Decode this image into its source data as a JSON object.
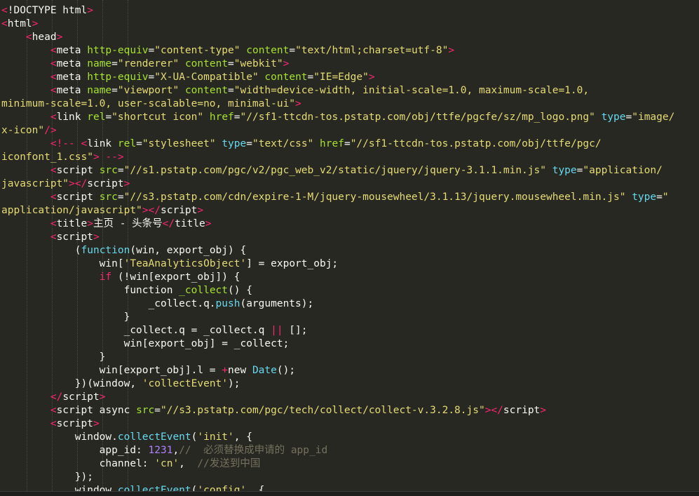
{
  "editor": {
    "theme_colors": {
      "background": "#272822",
      "tag": "#F92672",
      "attribute": "#A6E22E",
      "string": "#E6DB74",
      "keyword": "#66D9EF",
      "number": "#AE81FF",
      "comment": "#75715E",
      "text": "#F8F8F2"
    },
    "lines": [
      [
        [
          "tag",
          "<"
        ],
        [
          "plain",
          "!DOCTYPE html"
        ],
        [
          "tag",
          ">"
        ]
      ],
      [
        [
          "tag",
          "<"
        ],
        [
          "plain",
          "html"
        ],
        [
          "tag",
          ">"
        ]
      ],
      [
        [
          "plain",
          "    "
        ],
        [
          "tag",
          "<"
        ],
        [
          "plain",
          "head"
        ],
        [
          "tag",
          ">"
        ]
      ],
      [
        [
          "plain",
          "        "
        ],
        [
          "tag",
          "<"
        ],
        [
          "plain",
          "meta "
        ],
        [
          "attr",
          "http-equiv"
        ],
        [
          "plain",
          "="
        ],
        [
          "str",
          "\"content-type\""
        ],
        [
          "plain",
          " "
        ],
        [
          "attr",
          "content"
        ],
        [
          "plain",
          "="
        ],
        [
          "str",
          "\"text/html;charset=utf-8\""
        ],
        [
          "tag",
          ">"
        ]
      ],
      [
        [
          "plain",
          "        "
        ],
        [
          "tag",
          "<"
        ],
        [
          "plain",
          "meta "
        ],
        [
          "attr",
          "name"
        ],
        [
          "plain",
          "="
        ],
        [
          "str",
          "\"renderer\""
        ],
        [
          "plain",
          " "
        ],
        [
          "attr",
          "content"
        ],
        [
          "plain",
          "="
        ],
        [
          "str",
          "\"webkit\""
        ],
        [
          "tag",
          ">"
        ]
      ],
      [
        [
          "plain",
          "        "
        ],
        [
          "tag",
          "<"
        ],
        [
          "plain",
          "meta "
        ],
        [
          "attr",
          "http-equiv"
        ],
        [
          "plain",
          "="
        ],
        [
          "str",
          "\"X-UA-Compatible\""
        ],
        [
          "plain",
          " "
        ],
        [
          "attr",
          "content"
        ],
        [
          "plain",
          "="
        ],
        [
          "str",
          "\"IE=Edge\""
        ],
        [
          "tag",
          ">"
        ]
      ],
      [
        [
          "plain",
          "        "
        ],
        [
          "tag",
          "<"
        ],
        [
          "plain",
          "meta "
        ],
        [
          "attr",
          "name"
        ],
        [
          "plain",
          "="
        ],
        [
          "str",
          "\"viewport\""
        ],
        [
          "plain",
          " "
        ],
        [
          "attr",
          "content"
        ],
        [
          "plain",
          "="
        ],
        [
          "str",
          "\"width=device-width, initial-scale=1.0, maximum-scale=1.0,"
        ]
      ],
      [
        [
          "str",
          "minimum-scale=1.0, user-scalable=no, minimal-ui\""
        ],
        [
          "tag",
          ">"
        ]
      ],
      [
        [
          "plain",
          "        "
        ],
        [
          "tag",
          "<"
        ],
        [
          "plain",
          "link "
        ],
        [
          "attr",
          "rel"
        ],
        [
          "plain",
          "="
        ],
        [
          "str",
          "\"shortcut icon\""
        ],
        [
          "plain",
          " "
        ],
        [
          "attr",
          "href"
        ],
        [
          "plain",
          "="
        ],
        [
          "str",
          "\"//sf1-ttcdn-tos.pstatp.com/obj/ttfe/pgcfe/sz/mp_logo.png\""
        ],
        [
          "plain",
          " "
        ],
        [
          "kw",
          "type"
        ],
        [
          "plain",
          "="
        ],
        [
          "str",
          "\"image/"
        ]
      ],
      [
        [
          "str",
          "x-icon\""
        ],
        [
          "tag",
          "/>"
        ]
      ],
      [
        [
          "plain",
          "        "
        ],
        [
          "tag",
          "<!--"
        ],
        [
          "plain",
          " "
        ],
        [
          "tag",
          "<"
        ],
        [
          "plain",
          "link "
        ],
        [
          "attr",
          "rel"
        ],
        [
          "plain",
          "="
        ],
        [
          "str",
          "\"stylesheet\""
        ],
        [
          "plain",
          " "
        ],
        [
          "kw",
          "type"
        ],
        [
          "plain",
          "="
        ],
        [
          "str",
          "\"text/css\""
        ],
        [
          "plain",
          " "
        ],
        [
          "attr",
          "href"
        ],
        [
          "plain",
          "="
        ],
        [
          "str",
          "\"//sf1-ttcdn-tos.pstatp.com/obj/ttfe/pgc/"
        ]
      ],
      [
        [
          "str",
          "iconfont_1.css\""
        ],
        [
          "tag",
          "> -->"
        ]
      ],
      [
        [
          "plain",
          "        "
        ],
        [
          "tag",
          "<"
        ],
        [
          "plain",
          "script "
        ],
        [
          "attr",
          "src"
        ],
        [
          "plain",
          "="
        ],
        [
          "str",
          "\"//s1.pstatp.com/pgc/v2/pgc_web_v2/static/jquery/jquery-3.1.1.min.js\""
        ],
        [
          "plain",
          " "
        ],
        [
          "kw",
          "type"
        ],
        [
          "plain",
          "="
        ],
        [
          "str",
          "\"application/"
        ]
      ],
      [
        [
          "str",
          "javascript\""
        ],
        [
          "tag",
          "></"
        ],
        [
          "plain",
          "script"
        ],
        [
          "tag",
          ">"
        ]
      ],
      [
        [
          "plain",
          "        "
        ],
        [
          "tag",
          "<"
        ],
        [
          "plain",
          "script "
        ],
        [
          "attr",
          "src"
        ],
        [
          "plain",
          "="
        ],
        [
          "str",
          "\"//s3.pstatp.com/cdn/expire-1-M/jquery-mousewheel/3.1.13/jquery.mousewheel.min.js\""
        ],
        [
          "plain",
          " "
        ],
        [
          "kw",
          "type"
        ],
        [
          "plain",
          "="
        ],
        [
          "str",
          "\""
        ]
      ],
      [
        [
          "str",
          "application/javascript\""
        ],
        [
          "tag",
          "></"
        ],
        [
          "plain",
          "script"
        ],
        [
          "tag",
          ">"
        ]
      ],
      [
        [
          "plain",
          "        "
        ],
        [
          "tag",
          "<"
        ],
        [
          "plain",
          "title"
        ],
        [
          "tag",
          ">"
        ],
        [
          "plain",
          "主页 - 头条号"
        ],
        [
          "tag",
          "</"
        ],
        [
          "plain",
          "title"
        ],
        [
          "tag",
          ">"
        ]
      ],
      [
        [
          "plain",
          "        "
        ],
        [
          "tag",
          "<"
        ],
        [
          "plain",
          "script"
        ],
        [
          "tag",
          ">"
        ]
      ],
      [
        [
          "plain",
          "            ("
        ],
        [
          "kw",
          "function"
        ],
        [
          "plain",
          "(win, export_obj) {"
        ]
      ],
      [
        [
          "plain",
          "                win["
        ],
        [
          "str",
          "'TeaAnalyticsObject'"
        ],
        [
          "plain",
          "] = export_obj;"
        ]
      ],
      [
        [
          "plain",
          "                "
        ],
        [
          "tag",
          "if"
        ],
        [
          "plain",
          " (!win[export_obj]) {"
        ]
      ],
      [
        [
          "plain",
          "                    function "
        ],
        [
          "attr",
          "_collect"
        ],
        [
          "plain",
          "() {"
        ]
      ],
      [
        [
          "plain",
          "                        _collect.q."
        ],
        [
          "kw",
          "push"
        ],
        [
          "plain",
          "(arguments);"
        ]
      ],
      [
        [
          "plain",
          "                    }"
        ]
      ],
      [
        [
          "plain",
          "                    _collect.q = _collect.q "
        ],
        [
          "op",
          "||"
        ],
        [
          "plain",
          " [];"
        ]
      ],
      [
        [
          "plain",
          "                    win[export_obj] = _collect;"
        ]
      ],
      [
        [
          "plain",
          "                }"
        ]
      ],
      [
        [
          "plain",
          "                win[export_obj].l = "
        ],
        [
          "op",
          "+"
        ],
        [
          "plain",
          "new "
        ],
        [
          "kw",
          "Date"
        ],
        [
          "plain",
          "();"
        ]
      ],
      [
        [
          "plain",
          "            })(window, "
        ],
        [
          "str",
          "'collectEvent'"
        ],
        [
          "plain",
          ");"
        ]
      ],
      [
        [
          "plain",
          "        "
        ],
        [
          "tag",
          "</"
        ],
        [
          "plain",
          "script"
        ],
        [
          "tag",
          ">"
        ]
      ],
      [
        [
          "plain",
          "        "
        ],
        [
          "tag",
          "<"
        ],
        [
          "plain",
          "script async "
        ],
        [
          "attr",
          "src"
        ],
        [
          "plain",
          "="
        ],
        [
          "str",
          "\"//s3.pstatp.com/pgc/tech/collect/collect-v.3.2.8.js\""
        ],
        [
          "tag",
          "></"
        ],
        [
          "plain",
          "script"
        ],
        [
          "tag",
          ">"
        ]
      ],
      [
        [
          "plain",
          "        "
        ],
        [
          "tag",
          "<"
        ],
        [
          "plain",
          "script"
        ],
        [
          "tag",
          ">"
        ]
      ],
      [
        [
          "plain",
          "            window."
        ],
        [
          "kw",
          "collectEvent"
        ],
        [
          "plain",
          "("
        ],
        [
          "str",
          "'init'"
        ],
        [
          "plain",
          ", {"
        ]
      ],
      [
        [
          "plain",
          "                app_id: "
        ],
        [
          "num",
          "1231"
        ],
        [
          "plain",
          ","
        ],
        [
          "com",
          "//  必须替换成申请的 app_id"
        ]
      ],
      [
        [
          "plain",
          "                channel: "
        ],
        [
          "str",
          "'cn'"
        ],
        [
          "plain",
          ",  "
        ],
        [
          "com",
          "//发送到中国"
        ]
      ],
      [
        [
          "plain",
          "            });"
        ]
      ],
      [
        [
          "plain",
          "            window."
        ],
        [
          "kw",
          "collectEvent"
        ],
        [
          "plain",
          "("
        ],
        [
          "str",
          "'config'"
        ],
        [
          "plain",
          ", {"
        ]
      ]
    ]
  }
}
